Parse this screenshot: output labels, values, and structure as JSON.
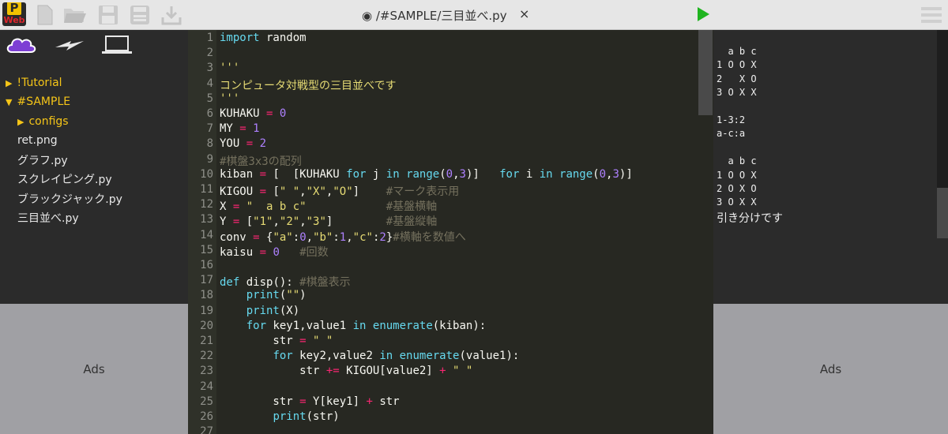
{
  "toolbar": {
    "tab_title": "◉ /#SAMPLE/三目並べ.py",
    "close": "×",
    "logo_top": "P",
    "logo_bottom": "Web"
  },
  "sidebar": {
    "tree": [
      {
        "label": "!Tutorial",
        "kind": "folder",
        "open": false
      },
      {
        "label": "#SAMPLE",
        "kind": "folder",
        "open": true
      },
      {
        "label": "configs",
        "kind": "folder",
        "open": false
      },
      {
        "label": "ret.png",
        "kind": "file"
      },
      {
        "label": "グラフ.py",
        "kind": "file"
      },
      {
        "label": "スクレイピング.py",
        "kind": "file"
      },
      {
        "label": "ブラックジャック.py",
        "kind": "file"
      },
      {
        "label": "三目並べ.py",
        "kind": "file"
      }
    ]
  },
  "ads": {
    "left": "Ads",
    "right": "Ads"
  },
  "editor": {
    "lines": [
      "import random",
      "",
      "'''",
      "コンピュータ対戦型の三目並べです",
      "'''",
      "KUHAKU = 0",
      "MY = 1",
      "YOU = 2",
      "#棋盤3x3の配列",
      "kiban = [  [KUHAKU for j in range(0,3)]   for i in range(0,3)]",
      "KIGOU = [\" \",\"X\",\"O\"]    #マーク表示用",
      "X = \"  a b c\"            #基盤横軸",
      "Y = [\"1\",\"2\",\"3\"]        #基盤縦軸",
      "conv = {\"a\":0,\"b\":1,\"c\":2}#横軸を数値へ",
      "kaisu = 0   #回数",
      "",
      "def disp(): #棋盤表示",
      "    print(\"\")",
      "    print(X)",
      "    for key1,value1 in enumerate(kiban):",
      "        str = \" \"",
      "        for key2,value2 in enumerate(value1):",
      "            str += KIGOU[value2] + \" \"",
      "",
      "        str = Y[key1] + str",
      "        print(str)",
      ""
    ]
  },
  "output": {
    "lines": [
      "  a b c",
      "1 O O X",
      "2   X O",
      "3 O X X",
      "",
      "1-3:2",
      "a-c:a",
      "",
      "  a b c",
      "1 O O X",
      "2 O X O",
      "3 O X X"
    ],
    "end": "引き分けです"
  }
}
